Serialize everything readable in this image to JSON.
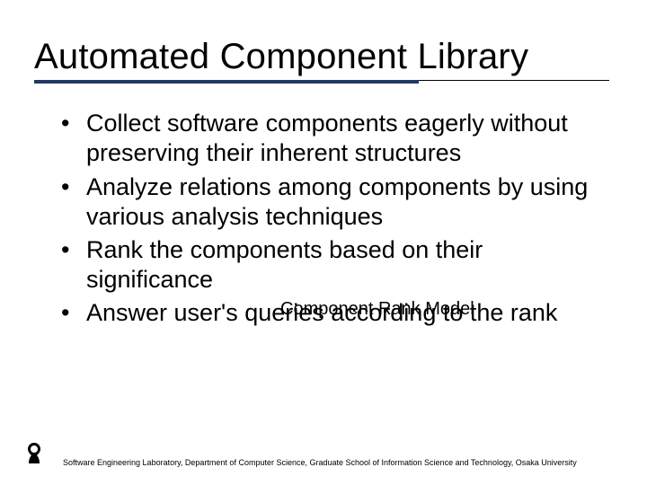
{
  "title": "Automated Component Library",
  "bullets": [
    "Collect software components eagerly without preserving their inherent structures",
    "Analyze relations among components by using various analysis techniques",
    "Rank the components based on their significance",
    "Answer user's queries according to the rank"
  ],
  "annotation": "Component Rank Model",
  "footer": "Software Engineering Laboratory, Department of Computer Science, Graduate School of Information Science and Technology, Osaka University"
}
